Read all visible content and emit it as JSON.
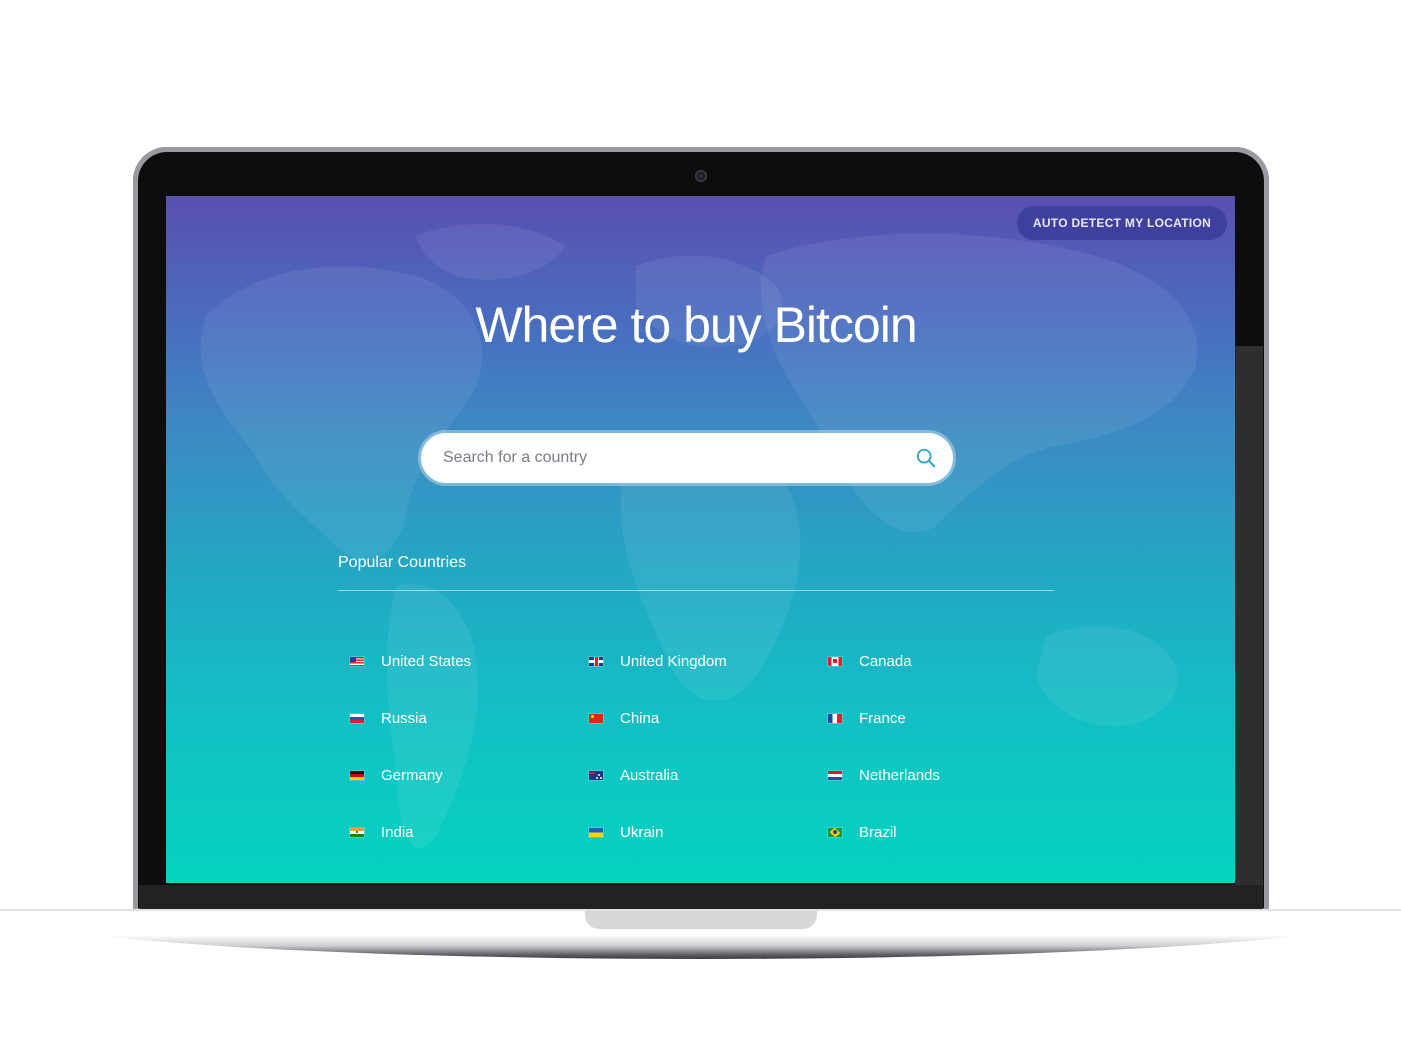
{
  "screen": {
    "auto_detect_label": "AUTO DETECT MY LOCATION",
    "title": "Where to buy Bitcoin",
    "search": {
      "placeholder": "Search for a country"
    },
    "popular_label": "Popular Countries",
    "countries": [
      {
        "name": "United States",
        "flag": "us-flag-icon"
      },
      {
        "name": "United Kingdom",
        "flag": "uk-flag-icon"
      },
      {
        "name": "Canada",
        "flag": "canada-flag-icon"
      },
      {
        "name": "Russia",
        "flag": "russia-flag-icon"
      },
      {
        "name": "China",
        "flag": "china-flag-icon"
      },
      {
        "name": "France",
        "flag": "france-flag-icon"
      },
      {
        "name": "Germany",
        "flag": "germany-flag-icon"
      },
      {
        "name": "Australia",
        "flag": "australia-flag-icon"
      },
      {
        "name": "Netherlands",
        "flag": "netherlands-flag-icon"
      },
      {
        "name": "India",
        "flag": "india-flag-icon"
      },
      {
        "name": "Ukrain",
        "flag": "ukraine-flag-icon"
      },
      {
        "name": "Brazil",
        "flag": "brazil-flag-icon"
      }
    ]
  },
  "colors": {
    "gradient_top": "#5a4fb0",
    "gradient_bottom": "#05d3c0",
    "button_bg": "#3f3f9e",
    "search_icon": "#2ea6c8"
  }
}
